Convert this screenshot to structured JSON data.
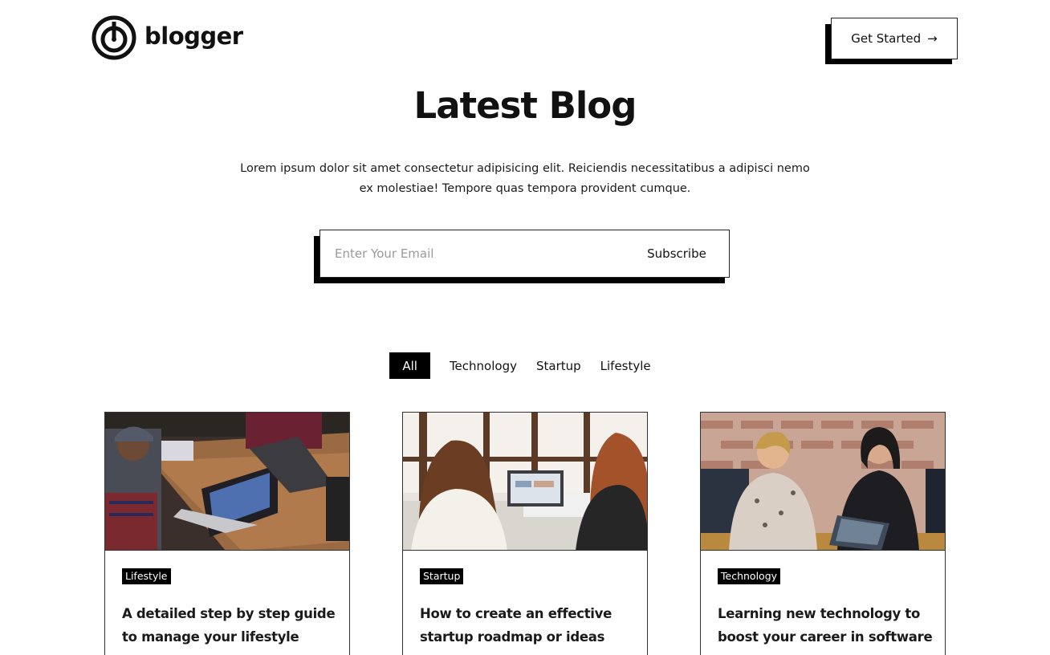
{
  "header": {
    "logo_text": "blogger",
    "cta_label": "Get Started",
    "cta_arrow": "→"
  },
  "hero": {
    "title": "Latest Blog",
    "lead": "Lorem ipsum dolor sit amet consectetur adipisicing elit. Reiciendis necessitatibus a adipisci nemo ex molestiae! Tempore quas tempora provident cumque."
  },
  "subscribe": {
    "placeholder": "Enter Your Email",
    "button_label": "Subscribe"
  },
  "filters": [
    {
      "label": "All",
      "active": true
    },
    {
      "label": "Technology",
      "active": false
    },
    {
      "label": "Startup",
      "active": false
    },
    {
      "label": "Lifestyle",
      "active": false
    }
  ],
  "posts": [
    {
      "tag": "Lifestyle",
      "title": "A detailed step by step guide to manage your lifestyle",
      "image": "team-meeting-laptops-photo"
    },
    {
      "tag": "Startup",
      "title": "How to create an effective startup roadmap or ideas",
      "image": "two-women-laptop-photo"
    },
    {
      "tag": "Technology",
      "title": "Learning new technology to boost your career in software",
      "image": "women-tablet-meeting-photo"
    }
  ],
  "colors": {
    "text": "#111111",
    "accent": "#000000",
    "background": "#ffffff"
  }
}
